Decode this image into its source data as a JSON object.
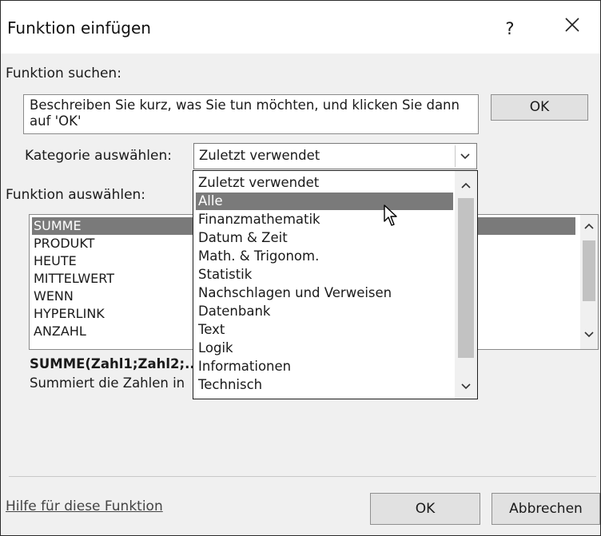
{
  "dialog": {
    "title": "Funktion einfügen",
    "help_label": "?"
  },
  "search": {
    "label": "Funktion suchen:",
    "value": "Beschreiben Sie kurz, was Sie tun möchten, und klicken Sie dann auf 'OK'",
    "go_label": "OK"
  },
  "category": {
    "label": "Kategorie auswählen:",
    "selected": "Zuletzt verwendet",
    "options": [
      "Zuletzt verwendet",
      "Alle",
      "Finanzmathematik",
      "Datum & Zeit",
      "Math. & Trigonom.",
      "Statistik",
      "Nachschlagen und Verweisen",
      "Datenbank",
      "Text",
      "Logik",
      "Informationen",
      "Technisch"
    ],
    "highlighted": "Alle"
  },
  "functions": {
    "label": "Funktion auswählen:",
    "items": [
      "SUMME",
      "PRODUKT",
      "HEUTE",
      "MITTELWERT",
      "WENN",
      "HYPERLINK",
      "ANZAHL"
    ],
    "selected": "SUMME"
  },
  "details": {
    "syntax": "SUMME(Zahl1;Zahl2;..",
    "description": "Summiert die Zahlen in"
  },
  "footer": {
    "help_link": "Hilfe für diese Funktion",
    "ok_label": "OK",
    "cancel_label": "Abbrechen"
  },
  "colors": {
    "selection": "#7a7a7a",
    "dialog_bg": "#f0f0f0"
  }
}
